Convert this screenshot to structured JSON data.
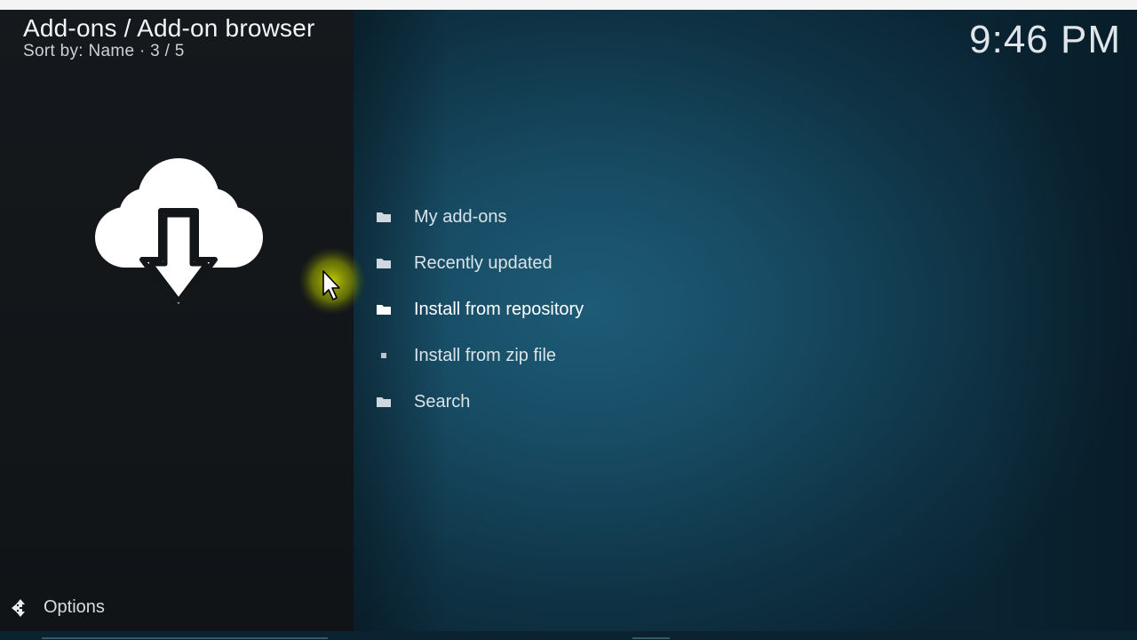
{
  "header": {
    "title": "Add-ons / Add-on browser",
    "sort_label": "Sort by: Name",
    "position": "3 / 5"
  },
  "clock": "9:46 PM",
  "menu": {
    "items": [
      {
        "label": "My add-ons",
        "icon": "folder-icon"
      },
      {
        "label": "Recently updated",
        "icon": "folder-icon"
      },
      {
        "label": "Install from repository",
        "icon": "folder-icon",
        "focused": true
      },
      {
        "label": "Install from zip file",
        "icon": "file-icon"
      },
      {
        "label": "Search",
        "icon": "folder-icon"
      }
    ]
  },
  "footer": {
    "options_label": "Options",
    "options_icon": "options-arrows-icon"
  },
  "colors": {
    "accent_teal": "#1d5b76",
    "left_panel": "#15191d",
    "cursor_highlight": "#c8d400"
  }
}
